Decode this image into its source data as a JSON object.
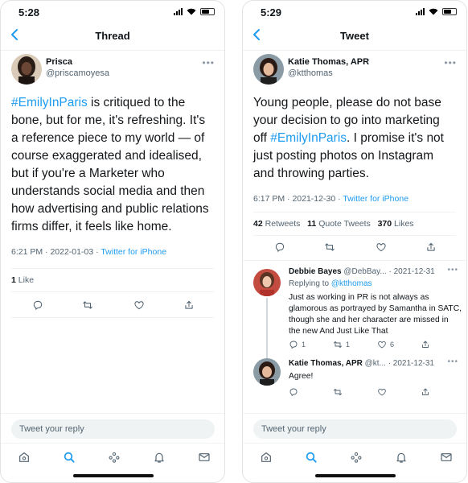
{
  "left": {
    "status_time": "5:28",
    "nav_title": "Thread",
    "author": {
      "name": "Prisca",
      "handle": "@priscamoyesa"
    },
    "tweet": {
      "hashtag": "#EmilyInParis",
      "text_after_hashtag": " is critiqued to the bone, but for me, it's refreshing. It's a reference piece to my world — of course exaggerated and idealised, but if you're a Marketer who understands social media and then how advertising and public relations firms differ, it feels like home.",
      "time": "6:21 PM",
      "date": "2022-01-03",
      "source": "Twitter for iPhone",
      "likes_count": "1",
      "likes_label": "Like"
    },
    "composer_placeholder": "Tweet your reply"
  },
  "right": {
    "status_time": "5:29",
    "nav_title": "Tweet",
    "author": {
      "name": "Katie Thomas, APR",
      "handle": "@ktthomas"
    },
    "tweet": {
      "text_before_hashtag": "Young people, please do not base your decision to go into marketing off ",
      "hashtag": "#EmilyInParis",
      "text_after_hashtag": ". I promise it's not just posting photos on Instagram and throwing parties.",
      "time": "6:17 PM",
      "date": "2021-12-30",
      "source": "Twitter for iPhone",
      "retweets_count": "42",
      "retweets_label": "Retweets",
      "quotes_count": "11",
      "quotes_label": "Quote Tweets",
      "likes_count": "370",
      "likes_label": "Likes"
    },
    "replies": [
      {
        "name": "Debbie Bayes",
        "handle": "@DebBay...",
        "date": "· 2021-12-31",
        "replying_prefix": "Replying to",
        "replying_to": "@ktthomas",
        "text": "Just as working in PR is not always as glamorous as portrayed by Samantha in SATC, though she and her character are missed in the new And Just Like That",
        "reply_count": "1",
        "retweet_count": "1",
        "like_count": "6"
      },
      {
        "name": "Katie Thomas, APR",
        "handle": "@kt...",
        "date": "· 2021-12-31",
        "text": "Agree!"
      }
    ],
    "composer_placeholder": "Tweet your reply"
  },
  "colors": {
    "accent": "#1d9bf0",
    "text": "#0f1419",
    "muted": "#536471"
  }
}
